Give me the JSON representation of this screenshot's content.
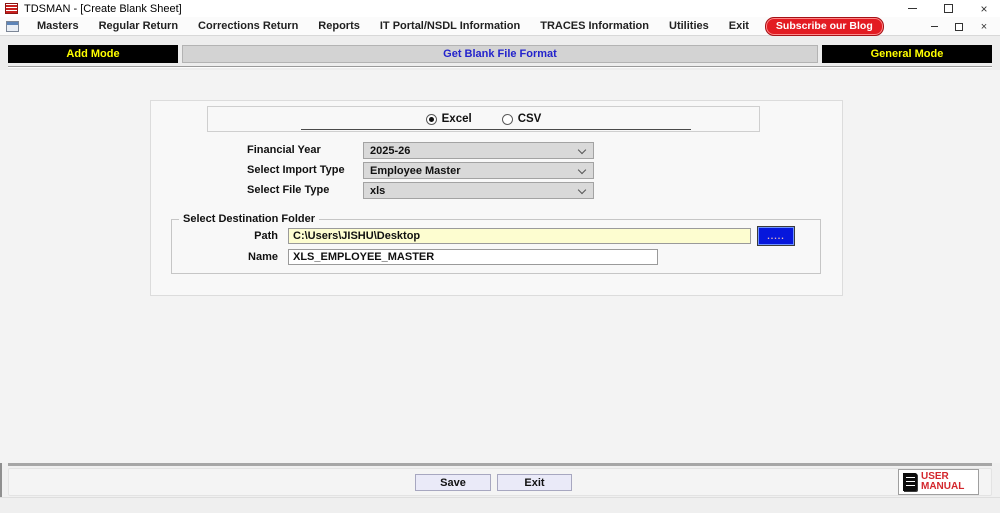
{
  "window": {
    "title": "TDSMAN - [Create Blank Sheet]",
    "icons": {
      "close_glyph": "×"
    }
  },
  "menu": {
    "items": [
      "Masters",
      "Regular Return",
      "Corrections Return",
      "Reports",
      "IT Portal/NSDL Information",
      "TRACES Information",
      "Utilities",
      "Exit"
    ],
    "subscribe_label": "Subscribe our Blog"
  },
  "mode_bar": {
    "left": "Add Mode",
    "center": "Get Blank File Format",
    "right": "General Mode"
  },
  "form": {
    "radio": {
      "excel": "Excel",
      "csv": "CSV",
      "selected": "Excel"
    },
    "fields": [
      {
        "label": "Financial Year",
        "value": "2025-26"
      },
      {
        "label": "Select Import Type",
        "value": "Employee Master"
      },
      {
        "label": "Select File Type",
        "value": "xls"
      }
    ],
    "destination": {
      "group_label": "Select Destination Folder",
      "path_label": "Path",
      "path_value": "C:\\Users\\JISHU\\Desktop",
      "browse_label": ".....",
      "name_label": "Name",
      "name_value": "XLS_EMPLOYEE_MASTER"
    }
  },
  "footer": {
    "save_label": "Save",
    "exit_label": "Exit",
    "user_manual_line1": "USER",
    "user_manual_line2": "MANUAL"
  },
  "colors": {
    "mode_bg": "#000000",
    "mode_text": "#FFFF00",
    "center_title_text": "#2323CC",
    "subscribe_bg": "#E31B22",
    "path_input_bg": "#FDFDD0",
    "browse_button_bg": "#0617DC",
    "manual_text": "#D3262C"
  }
}
